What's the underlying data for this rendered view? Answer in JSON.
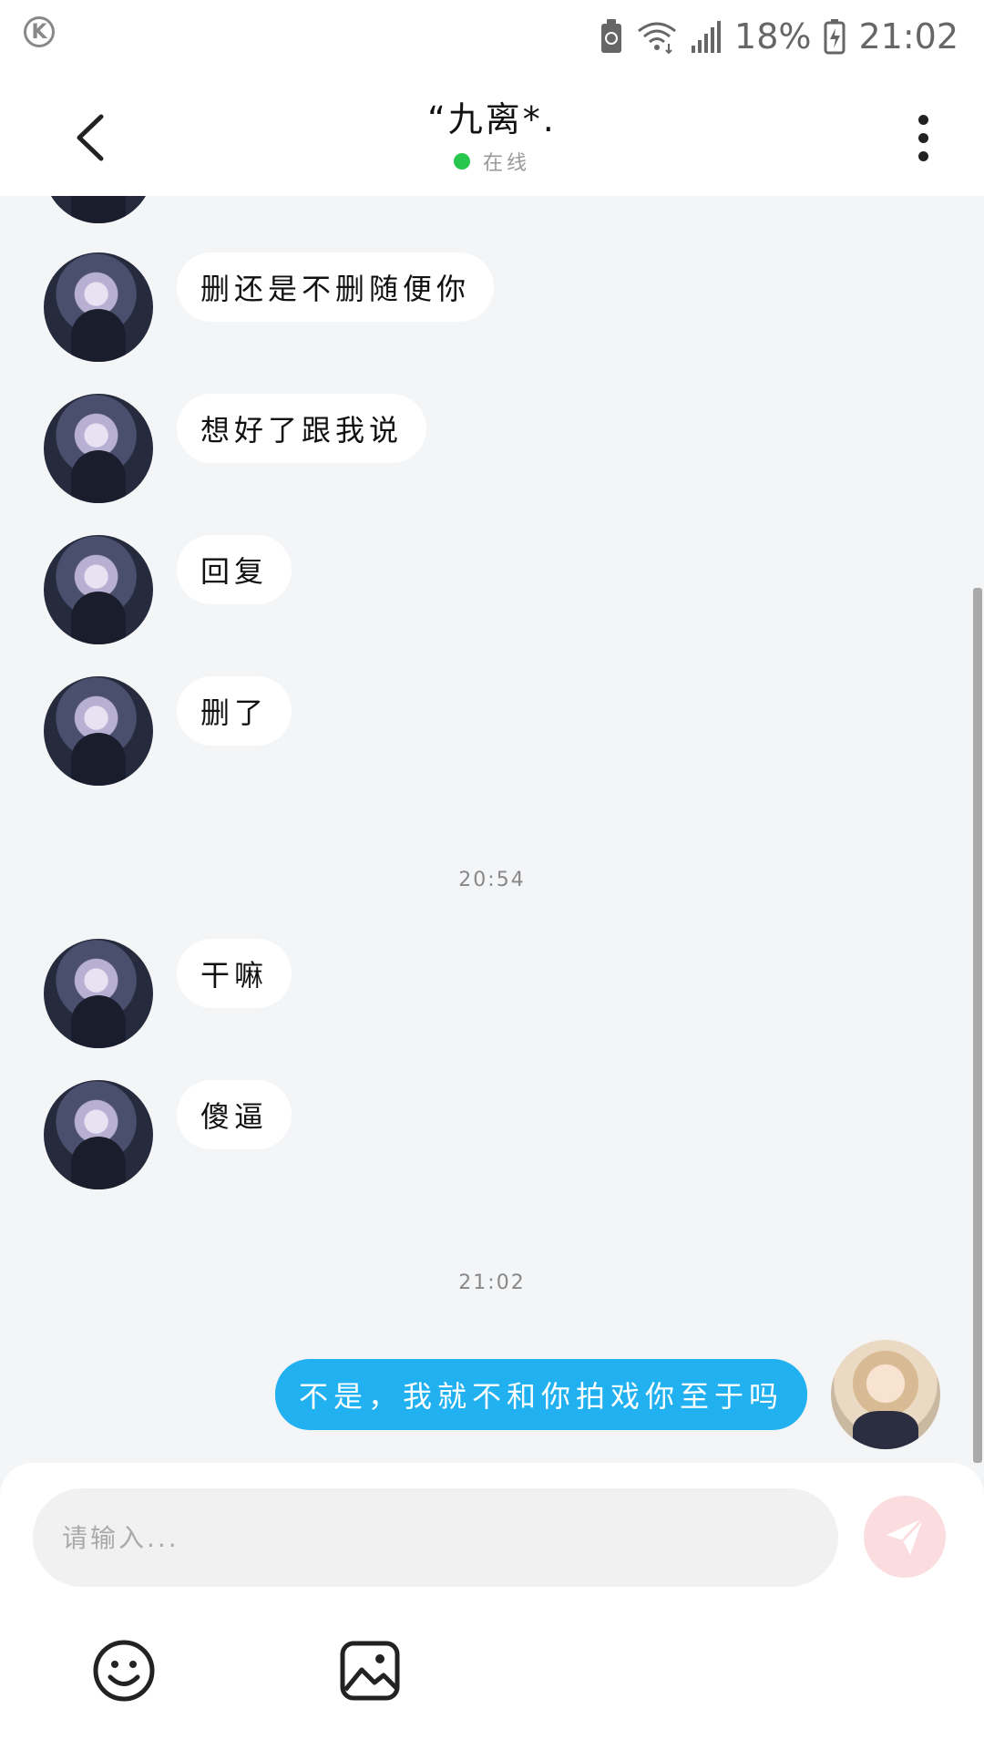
{
  "status_bar": {
    "battery_percent": "18%",
    "time": "21:02",
    "icons": [
      "k-app-icon",
      "battery-saver-icon",
      "wifi-icon",
      "signal-icon",
      "battery-charging-icon"
    ]
  },
  "header": {
    "title": "“九离*.",
    "status": "在线",
    "status_color": "#27c64d",
    "icons": [
      "back-arrow-icon",
      "more-vert-icon"
    ]
  },
  "messages": [
    {
      "from": "other",
      "text": "删还是不删随便你"
    },
    {
      "from": "other",
      "text": "想好了跟我说"
    },
    {
      "from": "other",
      "text": "回复"
    },
    {
      "from": "other",
      "text": "删了"
    },
    {
      "type": "time",
      "text": "20:54"
    },
    {
      "from": "other",
      "text": "干嘛"
    },
    {
      "from": "other",
      "text": "傻逼"
    },
    {
      "type": "time",
      "text": "21:02"
    },
    {
      "from": "me",
      "text": "不是，我就不和你拍戏你至于吗"
    }
  ],
  "composer": {
    "placeholder": "请输入...",
    "send_icon": "send-icon",
    "tools": [
      "emoji-icon",
      "image-icon"
    ],
    "send_color": "#fbdcdf",
    "my_bubble_color": "#22b1f0"
  }
}
